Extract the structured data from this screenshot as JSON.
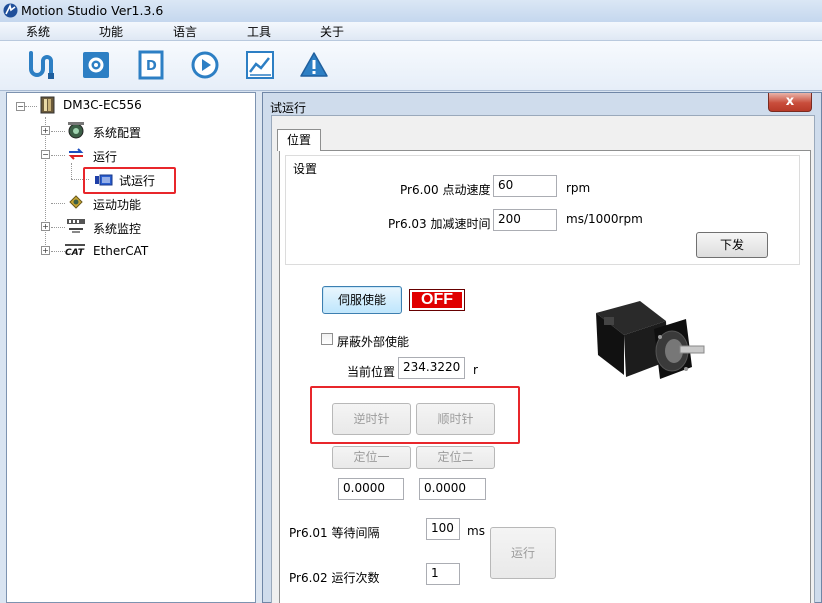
{
  "window": {
    "title": "Motion Studio  Ver1.3.6"
  },
  "menu": [
    "系统",
    "功能",
    "语言",
    "工具",
    "关于"
  ],
  "toolbar": {
    "icons": [
      "connect-icon",
      "parameter-icon",
      "document-icon",
      "run-icon",
      "chart-icon",
      "warning-icon"
    ],
    "accent": "#2d7fc4"
  },
  "tree": {
    "root": "DM3C-EC556",
    "items": [
      "系统配置",
      "运行",
      "试运行",
      "运动功能",
      "系统监控",
      "EtherCAT"
    ]
  },
  "dialog": {
    "title": "试运行",
    "close_symbol": "x",
    "tab": "位置",
    "settings": {
      "group_label": "设置",
      "speed_label": "Pr6.00 点动速度",
      "speed_value": "60",
      "speed_unit": "rpm",
      "accel_label": "Pr6.03 加减速时间",
      "accel_value": "200",
      "accel_unit": "ms/1000rpm",
      "send_button": "下发"
    },
    "servo_enable_button": "伺服使能",
    "status_badge": "OFF",
    "status_color": "#e00000",
    "shield_external_enable": "屏蔽外部使能",
    "current_position_label": "当前位置",
    "current_position_value": "234.3220",
    "current_position_unit": "r",
    "ccw_button": "逆时针",
    "cw_button": "顺时针",
    "position1_button": "定位一",
    "position2_button": "定位二",
    "position1_value": "0.0000",
    "position2_value": "0.0000",
    "wait_label": "Pr6.01 等待间隔",
    "wait_value": "100",
    "wait_unit": "ms",
    "run_count_label": "Pr6.02 运行次数",
    "run_count_value": "1",
    "run_button": "运行"
  },
  "highlight_color": "#e8262b"
}
